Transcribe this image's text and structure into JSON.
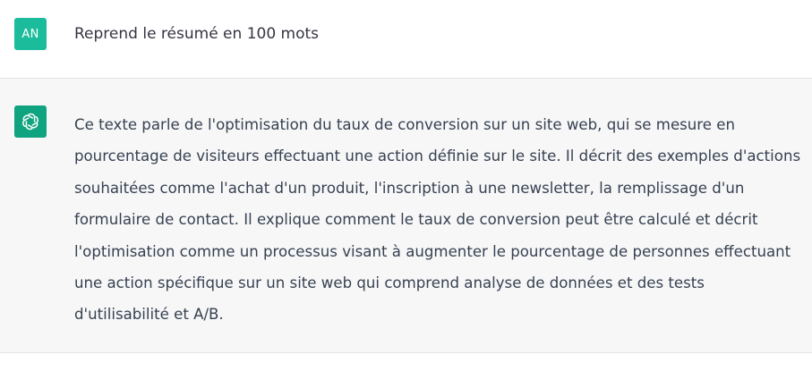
{
  "user_message": {
    "avatar_initials": "AN",
    "avatar_color": "#1bbc9b",
    "text": "Reprend le résumé en 100 mots"
  },
  "assistant_message": {
    "avatar_icon": "openai-logo-icon",
    "avatar_color": "#10a37f",
    "text": "Ce texte parle de l'optimisation du taux de conversion sur un site web, qui se mesure en pourcentage de visiteurs effectuant une action définie sur le site. Il décrit des exemples d'actions souhaitées comme l'achat d'un produit, l'inscription à une newsletter, la remplissage d'un formulaire de contact. Il explique comment le taux de conversion peut être calculé et décrit l'optimisation comme un processus visant à augmenter le pourcentage de personnes effectuant une action spécifique sur un site web qui comprend analyse de données et des tests d'utilisabilité et A/B."
  }
}
